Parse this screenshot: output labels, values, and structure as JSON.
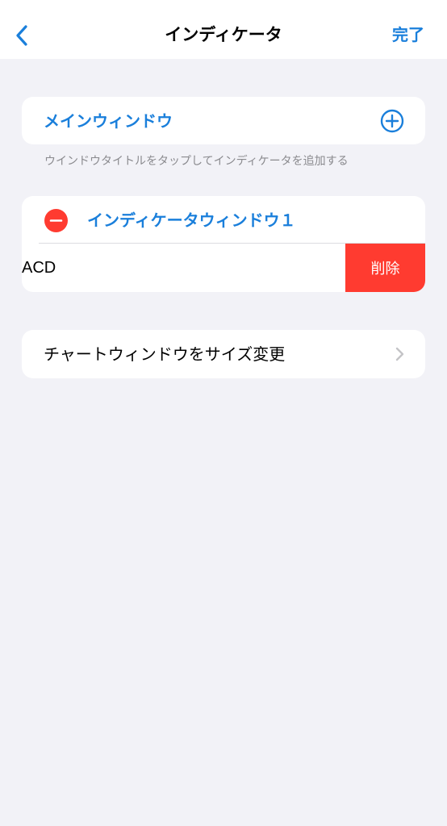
{
  "navbar": {
    "title": "インディケータ",
    "done_label": "完了",
    "back_icon": "chevron-left-icon"
  },
  "main_window": {
    "title": "メインウィンドウ",
    "add_icon": "plus-circle-icon"
  },
  "hint": "ウインドウタイトルをタップしてインディケータを追加する",
  "indicator_window": {
    "title": "インディケータウィンドウ１",
    "remove_icon": "minus-circle-icon",
    "items": [
      {
        "label": "ACD",
        "delete_label": "削除"
      }
    ]
  },
  "resize": {
    "label": "チャートウィンドウをサイズ変更",
    "chevron_icon": "chevron-right-icon"
  },
  "colors": {
    "accent": "#1a7fdb",
    "destructive": "#ff3b30",
    "background": "#f2f2f7"
  }
}
